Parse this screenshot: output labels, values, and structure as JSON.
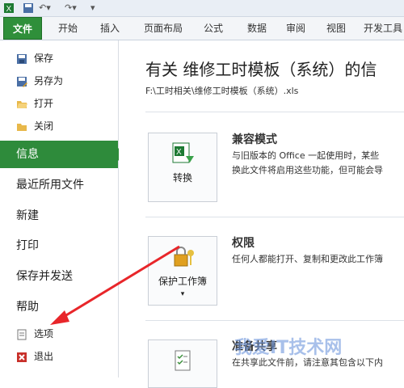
{
  "quick_access": {
    "icons": [
      "excel-icon",
      "save-icon",
      "undo-icon",
      "redo-icon"
    ]
  },
  "tabs": {
    "file": "文件",
    "items": [
      "开始",
      "插入",
      "页面布局",
      "公式",
      "数据",
      "审阅",
      "视图",
      "开发工具"
    ]
  },
  "backstage": {
    "commands": [
      {
        "label": "保存",
        "icon": "save-icon"
      },
      {
        "label": "另存为",
        "icon": "save-as-icon"
      },
      {
        "label": "打开",
        "icon": "open-folder-icon"
      },
      {
        "label": "关闭",
        "icon": "close-folder-icon"
      }
    ],
    "nav": [
      {
        "label": "信息",
        "active": true
      },
      {
        "label": "最近所用文件"
      },
      {
        "label": "新建"
      },
      {
        "label": "打印"
      },
      {
        "label": "保存并发送"
      },
      {
        "label": "帮助"
      }
    ],
    "bottom_commands": [
      {
        "label": "选项",
        "icon": "options-icon"
      },
      {
        "label": "退出",
        "icon": "exit-icon"
      }
    ]
  },
  "info": {
    "title": "有关 维修工时模板（系统）的信",
    "path": "F:\\工时相关\\维修工时模板（系统）.xls",
    "sections": [
      {
        "button": "转换",
        "title": "兼容模式",
        "desc": [
          "与旧版本的 Office 一起使用时，某些",
          "换此文件将启用这些功能，但可能会导"
        ]
      },
      {
        "button": "保护工作簿",
        "title": "权限",
        "desc": [
          "任何人都能打开、复制和更改此工作簿"
        ]
      },
      {
        "button": "",
        "title": "准备共享",
        "desc": [
          "在共享此文件前，请注意其包含以下内"
        ]
      }
    ]
  },
  "watermark": "我爱IT技术网"
}
